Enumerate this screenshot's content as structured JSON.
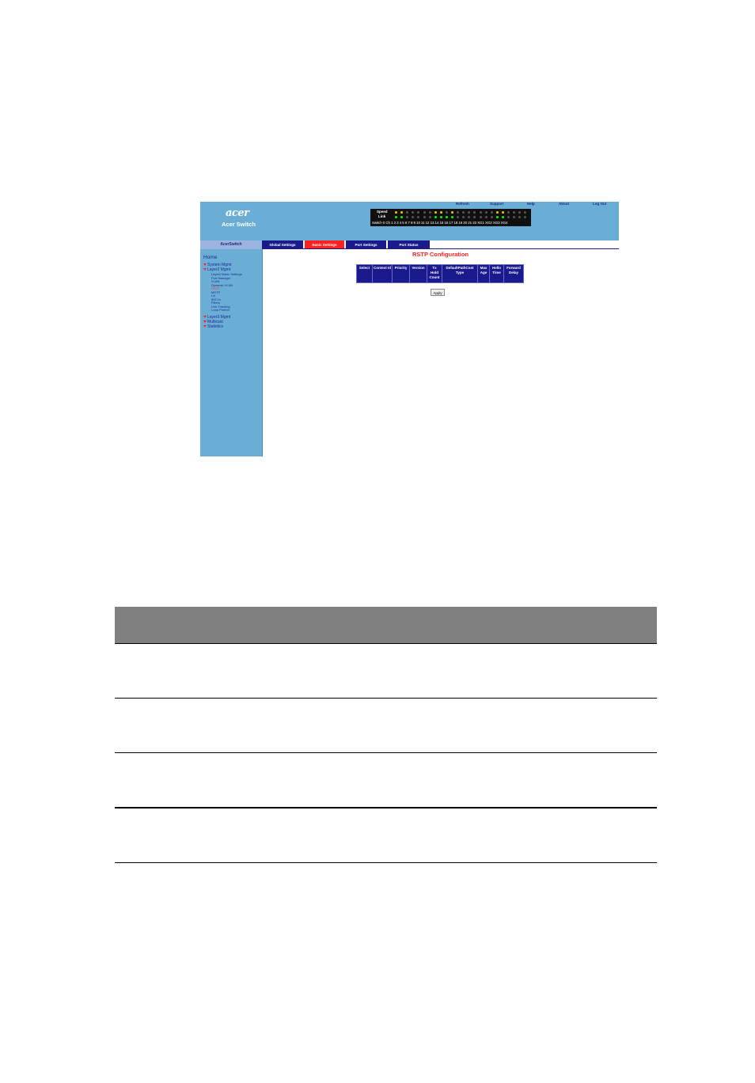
{
  "header": {
    "logo": "acer",
    "product_name": "Acer Switch",
    "links": [
      "Refresh",
      "Support",
      "Help",
      "About",
      "Log Out"
    ]
  },
  "status_panel": {
    "speed_label": "Speed",
    "link_label": "Link",
    "switch_label": "Switch 0 Ch",
    "port_numbers": "1 2 3 4 5 6 7 8 9 10 11 12 13 14 15 16 17 18 19 20 21 22 XG1 XG2 XG3 XG4",
    "led_colors": {
      "on_speed": "#ffc000",
      "on_link": "#00ff00",
      "off": "#555555"
    }
  },
  "sidebar": {
    "brand": "AcerSwitch",
    "home": "Home",
    "items": [
      {
        "label": "System Mgmt",
        "level": 1
      },
      {
        "label": "Layer2 Mgmt",
        "level": 1
      },
      {
        "label": "Layer2 Basic Settings",
        "level": 2
      },
      {
        "label": "Port Manager",
        "level": 2
      },
      {
        "label": "VLAN",
        "level": 2
      },
      {
        "label": "Dynamic VLAN",
        "level": 2
      },
      {
        "label": "RSTP",
        "level": 2,
        "selected": true
      },
      {
        "label": "MSTP",
        "level": 2
      },
      {
        "label": "LA",
        "level": 2
      },
      {
        "label": "802.1x",
        "level": 2
      },
      {
        "label": "Filters",
        "level": 2
      },
      {
        "label": "Link Tracking",
        "level": 2
      },
      {
        "label": "Loop Protect",
        "level": 2
      },
      {
        "label": "Layer3 Mgmt",
        "level": 1
      },
      {
        "label": "Multicast",
        "level": 1
      },
      {
        "label": "Statistics",
        "level": 1
      }
    ]
  },
  "tabs": [
    {
      "label": "Global Settings",
      "active": false
    },
    {
      "label": "Basic Settings",
      "active": true
    },
    {
      "label": "Port Settings",
      "active": false
    },
    {
      "label": "Port Status",
      "active": false
    }
  ],
  "main": {
    "title": "RSTP Configuration",
    "columns": [
      "Select",
      "Context Id",
      "Priority",
      "Version",
      "Tx Hold Count",
      "DefaultPathCost Type",
      "Max Age",
      "Hello Time",
      "Forward Delay"
    ],
    "apply_label": "Apply"
  },
  "colors": {
    "panel_blue": "#6aaed6",
    "nav_blue": "#1a1a8c",
    "accent_red": "#ff2020",
    "doc_header_gray": "#808080"
  }
}
